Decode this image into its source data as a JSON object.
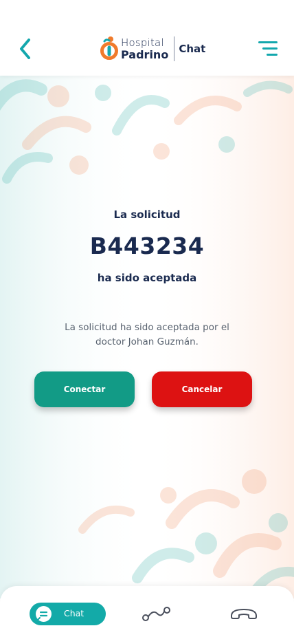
{
  "header": {
    "logo_line1": "Hospital",
    "logo_line2": "Padrino",
    "logo_section": "Chat"
  },
  "request": {
    "prefix": "La solicitud",
    "id": "B443234",
    "status": "ha sido aceptada",
    "description": "La solicitud ha sido aceptada por el doctor Johan Guzmán."
  },
  "actions": {
    "connect_label": "Conectar",
    "cancel_label": "Cancelar"
  },
  "bottom_nav": {
    "chat_label": "Chat"
  },
  "icons": {
    "back": "chevron-left-icon",
    "menu": "menu-icon",
    "chat": "chat-bubble-icon",
    "route": "route-icon",
    "phone": "hang-up-phone-icon"
  },
  "colors": {
    "primary_text": "#1a2a4f",
    "accent_teal": "#13a7ad",
    "connect_green": "#129b86",
    "cancel_red": "#dd1212",
    "muted_text": "#58626f"
  }
}
